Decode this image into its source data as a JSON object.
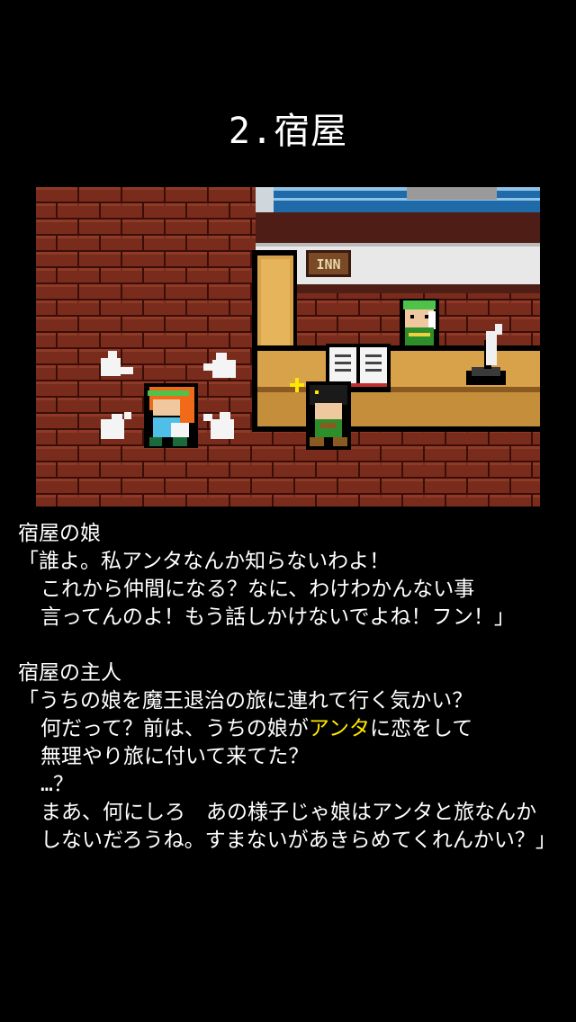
{
  "chapter_title": "2.宿屋",
  "scene": {
    "sign_label": "INN",
    "colors": {
      "brick": "#7a2c1c",
      "mortar": "#3a0e08",
      "counter": "#d8a24a",
      "wall": "#e8e8e8",
      "wood": "#4e1e16",
      "window": "#1f6aa8"
    }
  },
  "dialogue": {
    "daughter": {
      "speaker": "宿屋の娘",
      "lines": [
        "「誰よ。私アンタなんか知らないわよ！",
        "これから仲間になる？なに、わけわかんない事",
        "言ってんのよ！もう話しかけないでよね！フン！」"
      ]
    },
    "owner": {
      "speaker": "宿屋の主人",
      "line1": "「うちの娘を魔王退治の旅に連れて行く気かい？",
      "line2_before": "何だって？前は、うちの娘が",
      "line2_highlight": "アンタ",
      "line2_after": "に恋をして",
      "line3": "無理やり旅に付いて来てた？",
      "line4": "…？",
      "line5": "まあ、何にしろ　あの様子じゃ娘はアンタと旅なんか",
      "line6": "しないだろうね。すまないがあきらめてくれんかい？」",
      "highlight_color": "#ffe600"
    }
  }
}
